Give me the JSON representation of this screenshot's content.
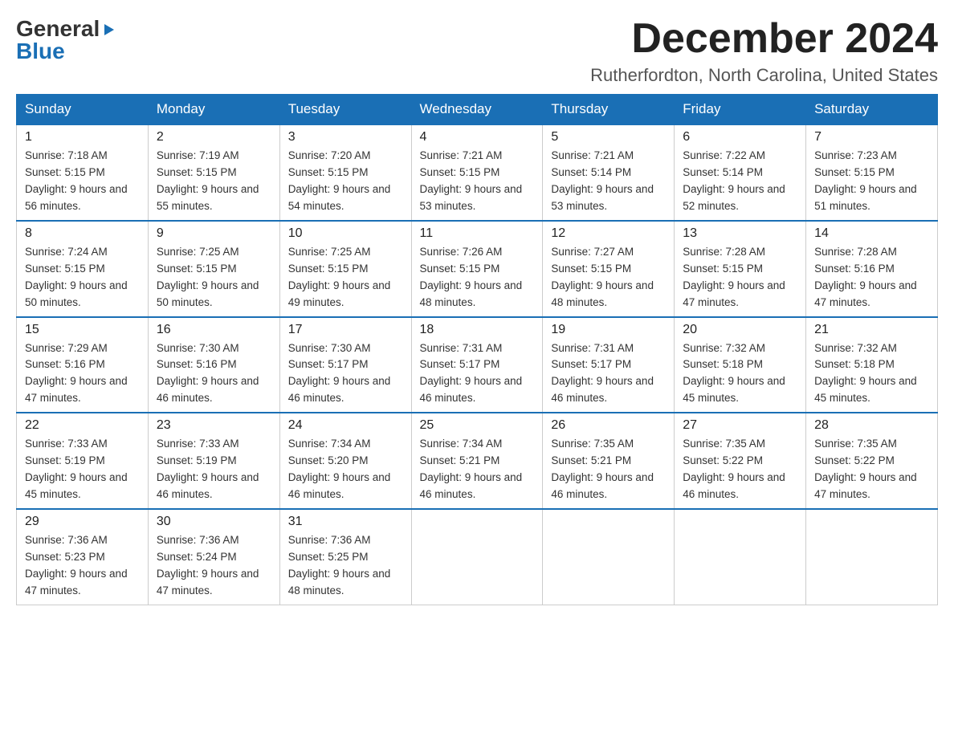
{
  "header": {
    "logo_general": "General",
    "logo_blue": "Blue",
    "month_title": "December 2024",
    "location": "Rutherfordton, North Carolina, United States"
  },
  "weekdays": [
    "Sunday",
    "Monday",
    "Tuesday",
    "Wednesday",
    "Thursday",
    "Friday",
    "Saturday"
  ],
  "weeks": [
    [
      {
        "day": "1",
        "sunrise": "7:18 AM",
        "sunset": "5:15 PM",
        "daylight": "9 hours and 56 minutes."
      },
      {
        "day": "2",
        "sunrise": "7:19 AM",
        "sunset": "5:15 PM",
        "daylight": "9 hours and 55 minutes."
      },
      {
        "day": "3",
        "sunrise": "7:20 AM",
        "sunset": "5:15 PM",
        "daylight": "9 hours and 54 minutes."
      },
      {
        "day": "4",
        "sunrise": "7:21 AM",
        "sunset": "5:15 PM",
        "daylight": "9 hours and 53 minutes."
      },
      {
        "day": "5",
        "sunrise": "7:21 AM",
        "sunset": "5:14 PM",
        "daylight": "9 hours and 53 minutes."
      },
      {
        "day": "6",
        "sunrise": "7:22 AM",
        "sunset": "5:14 PM",
        "daylight": "9 hours and 52 minutes."
      },
      {
        "day": "7",
        "sunrise": "7:23 AM",
        "sunset": "5:15 PM",
        "daylight": "9 hours and 51 minutes."
      }
    ],
    [
      {
        "day": "8",
        "sunrise": "7:24 AM",
        "sunset": "5:15 PM",
        "daylight": "9 hours and 50 minutes."
      },
      {
        "day": "9",
        "sunrise": "7:25 AM",
        "sunset": "5:15 PM",
        "daylight": "9 hours and 50 minutes."
      },
      {
        "day": "10",
        "sunrise": "7:25 AM",
        "sunset": "5:15 PM",
        "daylight": "9 hours and 49 minutes."
      },
      {
        "day": "11",
        "sunrise": "7:26 AM",
        "sunset": "5:15 PM",
        "daylight": "9 hours and 48 minutes."
      },
      {
        "day": "12",
        "sunrise": "7:27 AM",
        "sunset": "5:15 PM",
        "daylight": "9 hours and 48 minutes."
      },
      {
        "day": "13",
        "sunrise": "7:28 AM",
        "sunset": "5:15 PM",
        "daylight": "9 hours and 47 minutes."
      },
      {
        "day": "14",
        "sunrise": "7:28 AM",
        "sunset": "5:16 PM",
        "daylight": "9 hours and 47 minutes."
      }
    ],
    [
      {
        "day": "15",
        "sunrise": "7:29 AM",
        "sunset": "5:16 PM",
        "daylight": "9 hours and 47 minutes."
      },
      {
        "day": "16",
        "sunrise": "7:30 AM",
        "sunset": "5:16 PM",
        "daylight": "9 hours and 46 minutes."
      },
      {
        "day": "17",
        "sunrise": "7:30 AM",
        "sunset": "5:17 PM",
        "daylight": "9 hours and 46 minutes."
      },
      {
        "day": "18",
        "sunrise": "7:31 AM",
        "sunset": "5:17 PM",
        "daylight": "9 hours and 46 minutes."
      },
      {
        "day": "19",
        "sunrise": "7:31 AM",
        "sunset": "5:17 PM",
        "daylight": "9 hours and 46 minutes."
      },
      {
        "day": "20",
        "sunrise": "7:32 AM",
        "sunset": "5:18 PM",
        "daylight": "9 hours and 45 minutes."
      },
      {
        "day": "21",
        "sunrise": "7:32 AM",
        "sunset": "5:18 PM",
        "daylight": "9 hours and 45 minutes."
      }
    ],
    [
      {
        "day": "22",
        "sunrise": "7:33 AM",
        "sunset": "5:19 PM",
        "daylight": "9 hours and 45 minutes."
      },
      {
        "day": "23",
        "sunrise": "7:33 AM",
        "sunset": "5:19 PM",
        "daylight": "9 hours and 46 minutes."
      },
      {
        "day": "24",
        "sunrise": "7:34 AM",
        "sunset": "5:20 PM",
        "daylight": "9 hours and 46 minutes."
      },
      {
        "day": "25",
        "sunrise": "7:34 AM",
        "sunset": "5:21 PM",
        "daylight": "9 hours and 46 minutes."
      },
      {
        "day": "26",
        "sunrise": "7:35 AM",
        "sunset": "5:21 PM",
        "daylight": "9 hours and 46 minutes."
      },
      {
        "day": "27",
        "sunrise": "7:35 AM",
        "sunset": "5:22 PM",
        "daylight": "9 hours and 46 minutes."
      },
      {
        "day": "28",
        "sunrise": "7:35 AM",
        "sunset": "5:22 PM",
        "daylight": "9 hours and 47 minutes."
      }
    ],
    [
      {
        "day": "29",
        "sunrise": "7:36 AM",
        "sunset": "5:23 PM",
        "daylight": "9 hours and 47 minutes."
      },
      {
        "day": "30",
        "sunrise": "7:36 AM",
        "sunset": "5:24 PM",
        "daylight": "9 hours and 47 minutes."
      },
      {
        "day": "31",
        "sunrise": "7:36 AM",
        "sunset": "5:25 PM",
        "daylight": "9 hours and 48 minutes."
      },
      null,
      null,
      null,
      null
    ]
  ]
}
